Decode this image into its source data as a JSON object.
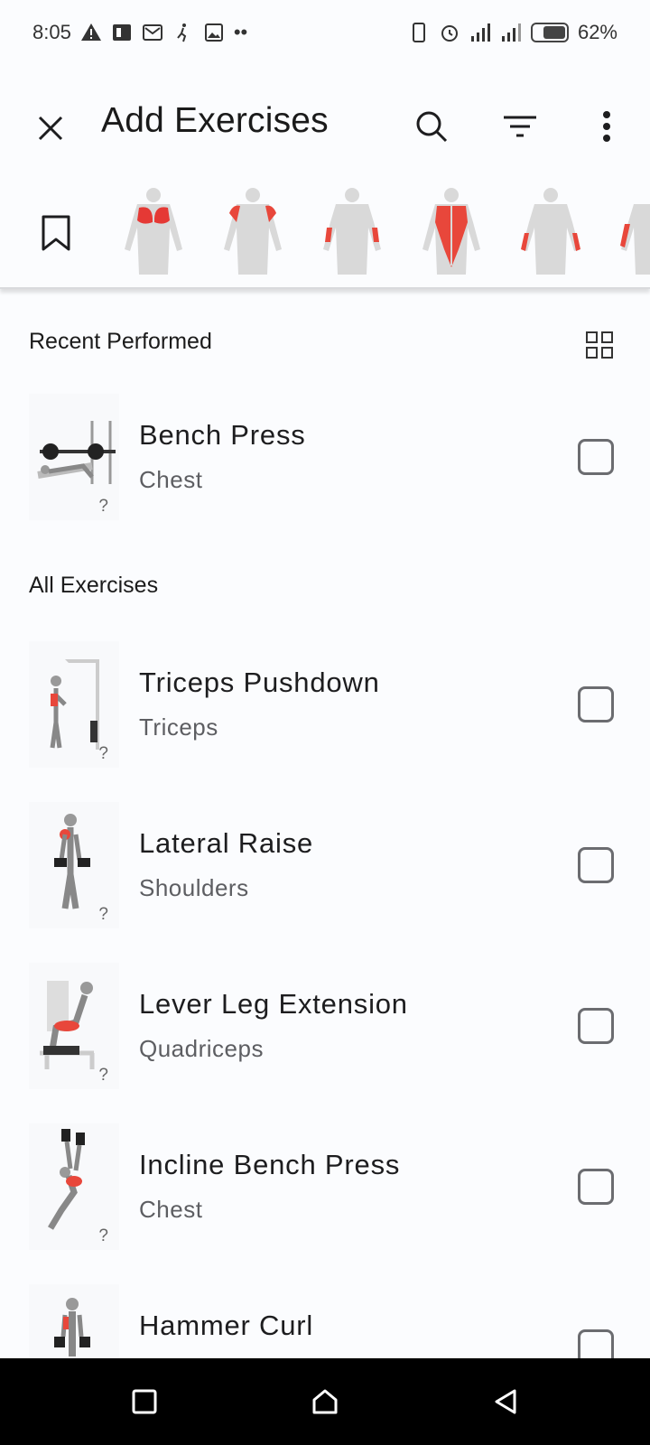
{
  "status_bar": {
    "time": "8:05",
    "battery": "62%",
    "battery_level": 0.62
  },
  "app_bar": {
    "title": "Add Exercises"
  },
  "muscle_filters": [
    {
      "icon": "chest-muscle-icon"
    },
    {
      "icon": "shoulders-muscle-icon"
    },
    {
      "icon": "biceps-muscle-icon"
    },
    {
      "icon": "back-muscle-icon"
    },
    {
      "icon": "forearms-muscle-icon"
    },
    {
      "icon": "triceps-muscle-icon"
    }
  ],
  "sections": {
    "recent": "Recent Performed",
    "all": "All Exercises"
  },
  "recent_exercises": [
    {
      "name": "Bench Press",
      "muscle": "Chest",
      "help": "?"
    }
  ],
  "all_exercises": [
    {
      "name": "Triceps Pushdown",
      "muscle": "Triceps",
      "help": "?"
    },
    {
      "name": "Lateral Raise",
      "muscle": "Shoulders",
      "help": "?"
    },
    {
      "name": "Lever Leg Extension",
      "muscle": "Quadriceps",
      "help": "?"
    },
    {
      "name": "Incline Bench Press",
      "muscle": "Chest",
      "help": "?"
    },
    {
      "name": "Hammer Curl",
      "muscle": "",
      "help": ""
    }
  ],
  "colors": {
    "accent": "#e8473b",
    "muscle_gray": "#d9d9d9"
  }
}
